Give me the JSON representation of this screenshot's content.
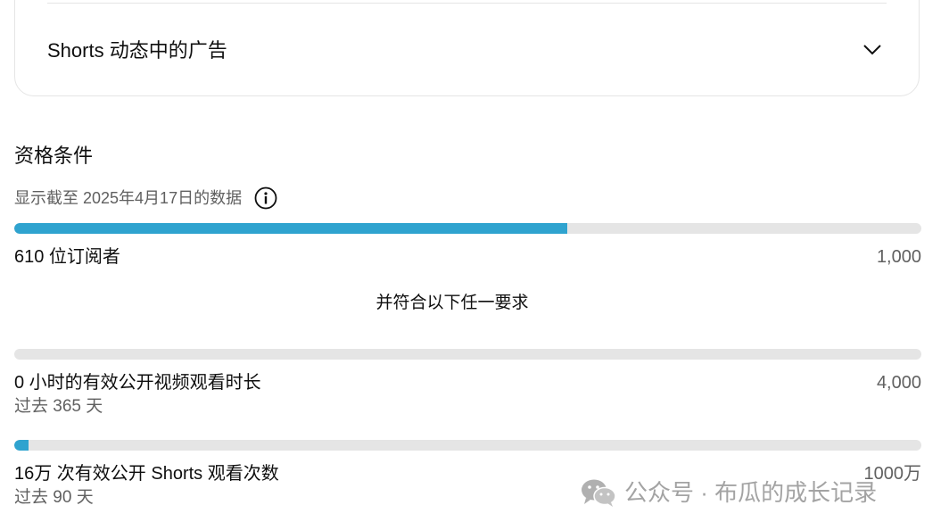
{
  "ads_card": {
    "title": "Shorts 动态中的广告"
  },
  "eligibility": {
    "title": "资格条件",
    "data_as_of": "显示截至 2025年4月17日的数据",
    "subscribers": {
      "current": "610 位订阅者",
      "target": "1,000",
      "progress": 0.61
    },
    "any_of_text": "并符合以下任一要求",
    "watch_hours": {
      "current": "0 小时的有效公开视频观看时长",
      "period": "过去 365 天",
      "target": "4,000",
      "progress": 0.0
    },
    "shorts_views": {
      "current": "16万 次有效公开 Shorts 观看次数",
      "period": "过去 90 天",
      "target": "1000万",
      "progress": 0.016
    }
  },
  "watermark": {
    "text": "公众号 · 布瓜的成长记录"
  },
  "colors": {
    "progress_fill": "#2fa3cf",
    "progress_track": "#e5e5e5"
  }
}
